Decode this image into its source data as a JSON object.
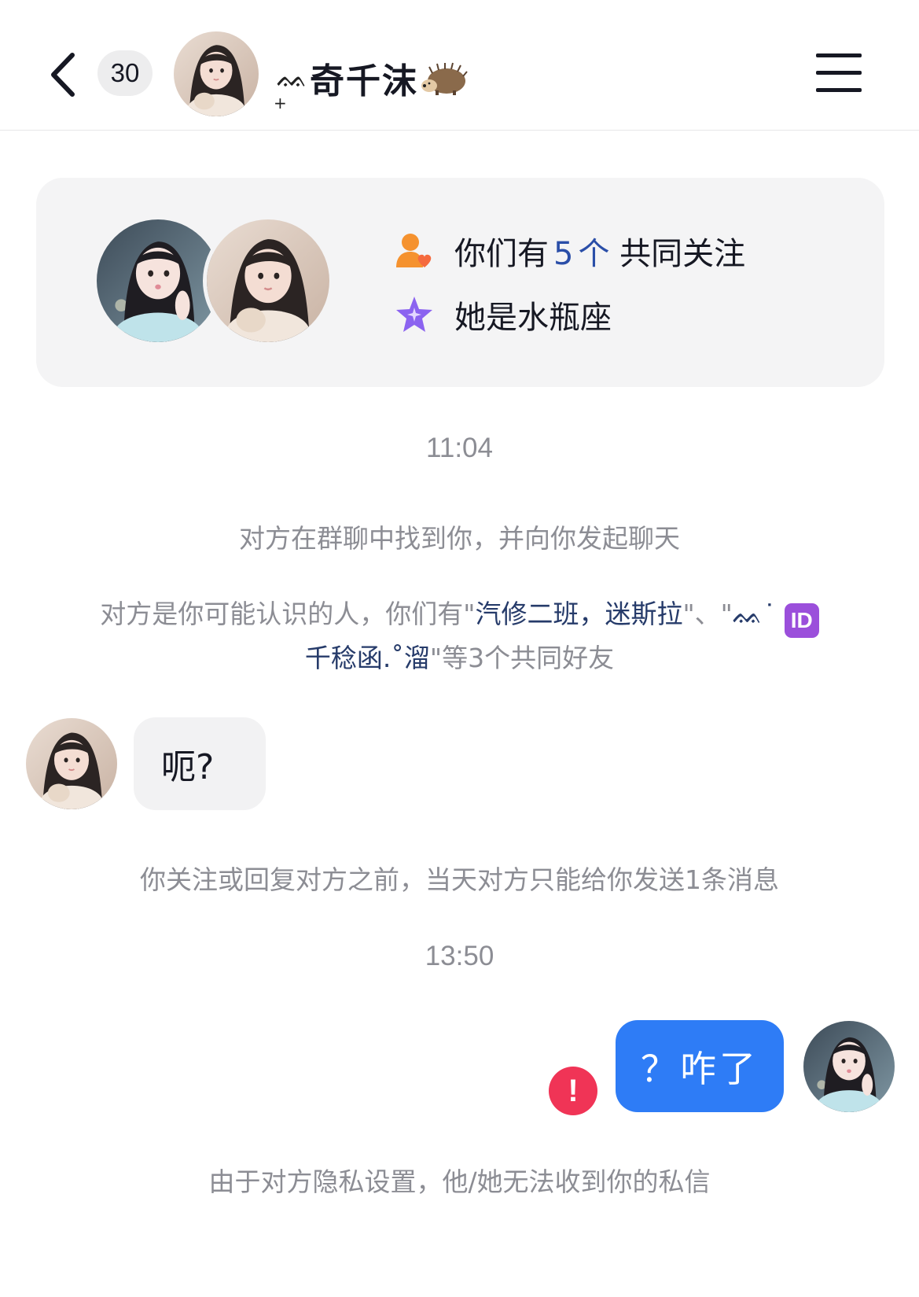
{
  "header": {
    "unread_count": "30",
    "name_deco": "ᨐ",
    "name_deco_small": "+",
    "contact_name": "奇千沫",
    "name_emoji_icon": "hedgehog-icon",
    "back_icon": "chevron-left-icon",
    "menu_icon": "hamburger-menu-icon"
  },
  "info_card": {
    "mutual_prefix": "你们有",
    "mutual_count": "5",
    "mutual_unit": "个",
    "mutual_suffix": "共同关注",
    "zodiac": "她是水瓶座",
    "mutual_icon": "users-heart-icon",
    "zodiac_icon": "star-sparkle-icon"
  },
  "timeline": {
    "time1": "11:04",
    "found_in_group": "对方在群聊中找到你，并向你发起聊天",
    "friends_prefix": "对方是你可能认识的人，你们有\"",
    "friend1": "汽修二班，迷斯拉",
    "friends_sep": "\"、\"",
    "friend2_deco": "ᨐ˙",
    "friend2_badge": "ID",
    "friend2_name": "千稔函.˚溜",
    "friends_suffix": "\"等3个共同好友",
    "limit_notice": "你关注或回复对方之前，当天对方只能给你发送1条消息",
    "time2": "13:50",
    "privacy_notice": "由于对方隐私设置，他/她无法收到你的私信"
  },
  "messages": [
    {
      "from": "them",
      "text": "呃?"
    },
    {
      "from": "me",
      "text": "？咋了",
      "status_icon": "error-exclamation-icon",
      "status_mark": "!"
    }
  ],
  "colors": {
    "accent_blue": "#2e7cf6",
    "link_blue": "#263b6a",
    "error_red": "#f03456",
    "mutual_orange": "#f5922f",
    "zodiac_purple": "#8b63f0"
  }
}
